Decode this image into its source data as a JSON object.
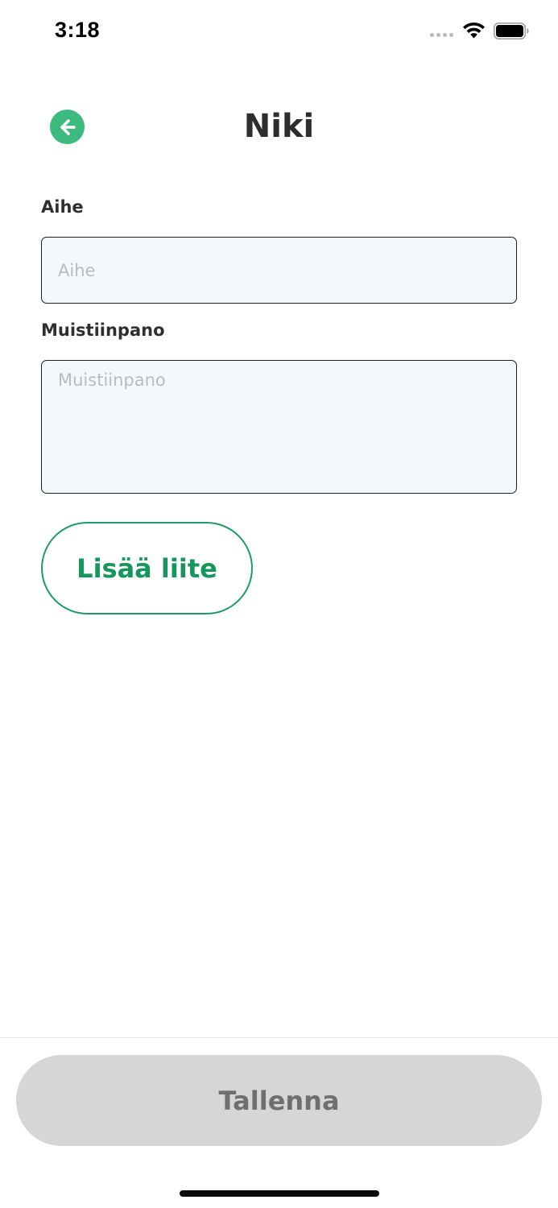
{
  "status_bar": {
    "time": "3:18",
    "icons": [
      "cellular-signal-icon",
      "wifi-icon",
      "battery-icon"
    ]
  },
  "header": {
    "title": "Niki",
    "back_icon": "arrow-left-circle-icon",
    "accent_color": "#3dbb7f"
  },
  "form": {
    "subject": {
      "label": "Aihe",
      "placeholder": "Aihe",
      "value": ""
    },
    "note": {
      "label": "Muistiinpano",
      "placeholder": "Muistiinpano",
      "value": ""
    },
    "attach_button_label": "Lisää liite"
  },
  "footer": {
    "save_label": "Tallenna",
    "save_enabled": false
  },
  "colors": {
    "brand_green": "#15965c",
    "disabled_button": "#d6d6d6",
    "input_background": "#f5f8fb"
  }
}
